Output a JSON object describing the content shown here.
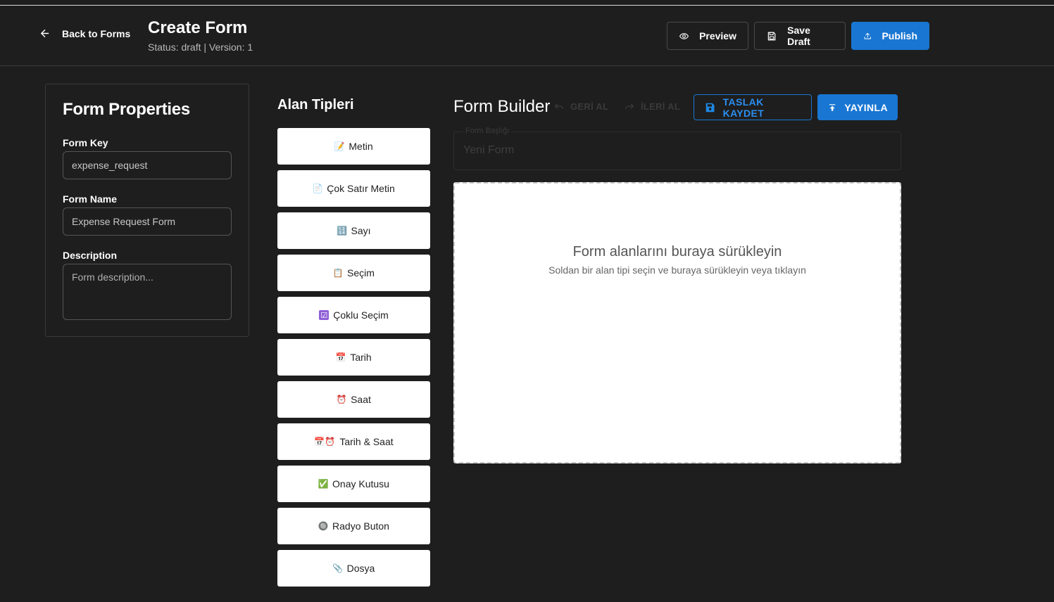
{
  "header": {
    "back_label": "Back to Forms",
    "title": "Create Form",
    "status": "Status: draft | Version: 1",
    "preview_label": "Preview",
    "save_draft_label": "Save Draft",
    "publish_label": "Publish"
  },
  "properties": {
    "heading": "Form Properties",
    "form_key_label": "Form Key",
    "form_key_value": "expense_request",
    "form_name_label": "Form Name",
    "form_name_value": "Expense Request Form",
    "description_label": "Description",
    "description_placeholder": "Form description..."
  },
  "field_types": {
    "heading": "Alan Tipleri",
    "items": [
      {
        "icon": "📝",
        "label": "Metin"
      },
      {
        "icon": "📄",
        "label": "Çok Satır Metin"
      },
      {
        "icon": "🔢",
        "label": "Sayı"
      },
      {
        "icon": "📋",
        "label": "Seçim"
      },
      {
        "icon": "☑",
        "label": "Çoklu Seçim"
      },
      {
        "icon": "📅",
        "label": "Tarih"
      },
      {
        "icon": "⏰",
        "label": "Saat"
      },
      {
        "icon": "📅⏰",
        "label": "Tarih & Saat"
      },
      {
        "icon": "✅",
        "label": "Onay Kutusu"
      },
      {
        "icon": "🔘",
        "label": "Radyo Buton"
      },
      {
        "icon": "📎",
        "label": "Dosya"
      }
    ]
  },
  "builder": {
    "heading": "Form Builder",
    "undo_label": "GERİ AL",
    "redo_label": "İLERİ AL",
    "save_draft_label": "TASLAK KAYDET",
    "publish_label": "YAYINLA",
    "form_title_label": "Form Başlığı",
    "form_title_value": "Yeni Form",
    "drop_heading": "Form alanlarını buraya sürükleyin",
    "drop_subtext": "Soldan bir alan tipi seçin ve buraya sürükleyin veya tıklayın"
  },
  "colors": {
    "background": "#1e1e1e",
    "primary": "#1976d2",
    "card": "#ffffff"
  }
}
